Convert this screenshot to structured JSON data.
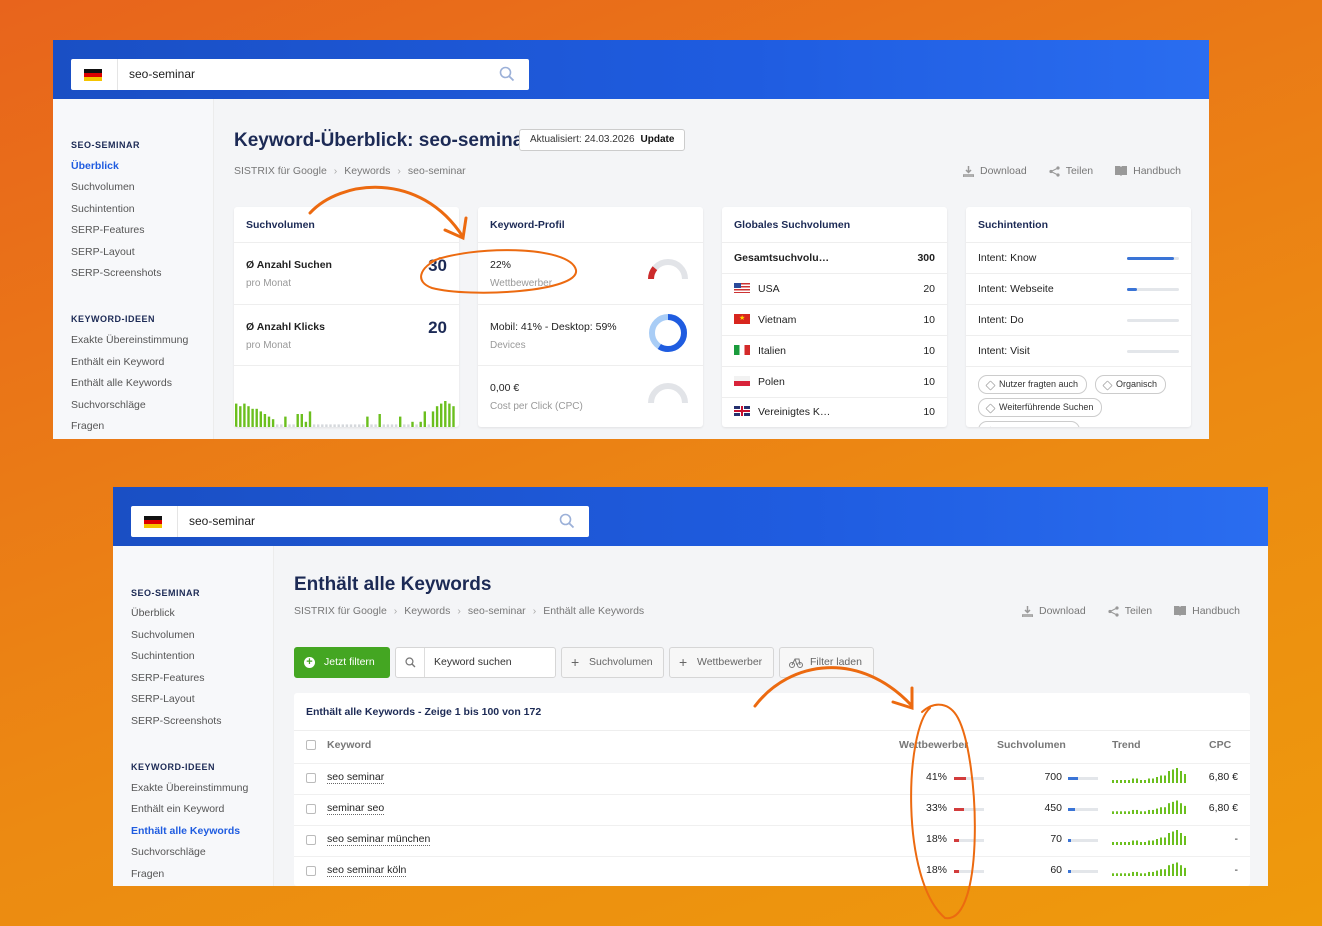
{
  "colors": {
    "accent": "#1f5ce0",
    "green": "#44a622",
    "annotation": "#ec6a10",
    "bar_red": "#d23c3c",
    "bar_blue": "#3a74d6"
  },
  "overview": {
    "search": {
      "query": "seo-seminar"
    },
    "sidebar": {
      "section1": "SEO-SEMINAR",
      "items1": [
        "Überblick",
        "Suchvolumen",
        "Suchintention",
        "SERP-Features",
        "SERP-Layout",
        "SERP-Screenshots"
      ],
      "section2": "KEYWORD-IDEEN",
      "items2": [
        "Exakte Übereinstimmung",
        "Enthält ein Keyword",
        "Enthält alle Keywords",
        "Suchvorschläge",
        "Fragen"
      ]
    },
    "title": "Keyword-Überblick: seo-seminar",
    "updated": "Aktualisiert: 24.03.2026",
    "update_btn": "Update",
    "breadcrumb": [
      "SISTRIX für Google",
      "Keywords",
      "seo-seminar"
    ],
    "actions": {
      "download": "Download",
      "share": "Teilen",
      "manual": "Handbuch"
    },
    "suchvolumen": {
      "title": "Suchvolumen",
      "searches_label": "Ø Anzahl Suchen",
      "searches_sub": "pro Monat",
      "searches_value": "30",
      "clicks_label": "Ø Anzahl Klicks",
      "clicks_sub": "pro Monat",
      "clicks_value": "20"
    },
    "profil": {
      "title": "Keyword-Profil",
      "comp_value": "22%",
      "comp_label": "Wettbewerber",
      "comp_pct": 22,
      "device_value": "Mobil: 41% - Desktop: 59%",
      "device_label": "Devices",
      "mobile_pct": 41,
      "cpc_value": "0,00 €",
      "cpc_label": "Cost per Click (CPC)"
    },
    "global": {
      "title": "Globales Suchvolumen",
      "total_label": "Gesamtsuchvolu…",
      "total_value": "300",
      "countries": [
        {
          "name": "USA",
          "value": "20",
          "flag": "us-flag"
        },
        {
          "name": "Vietnam",
          "value": "10",
          "flag": "vn-flag"
        },
        {
          "name": "Italien",
          "value": "10",
          "flag": "it-flag"
        },
        {
          "name": "Polen",
          "value": "10",
          "flag": "pl-flag"
        },
        {
          "name": "Vereinigtes K…",
          "value": "10",
          "flag": "gb-flag"
        }
      ]
    },
    "intent": {
      "title": "Suchintention",
      "items": [
        {
          "label": "Intent: Know",
          "level": 0.9
        },
        {
          "label": "Intent: Webseite",
          "level": 0.2
        },
        {
          "label": "Intent: Do",
          "level": 0
        },
        {
          "label": "Intent: Visit",
          "level": 0
        }
      ],
      "chips": [
        "Nutzer fragten auch",
        "Organisch",
        "Weiterführende Suchen"
      ]
    }
  },
  "detail": {
    "search": {
      "query": "seo-seminar"
    },
    "sidebar": {
      "section1": "SEO-SEMINAR",
      "items1": [
        "Überblick",
        "Suchvolumen",
        "Suchintention",
        "SERP-Features",
        "SERP-Layout",
        "SERP-Screenshots"
      ],
      "section2": "KEYWORD-IDEEN",
      "items2": [
        "Exakte Übereinstimmung",
        "Enthält ein Keyword",
        "Enthält alle Keywords",
        "Suchvorschläge",
        "Fragen"
      ]
    },
    "title": "Enthält alle Keywords",
    "breadcrumb": [
      "SISTRIX für Google",
      "Keywords",
      "seo-seminar",
      "Enthält alle Keywords"
    ],
    "actions": {
      "download": "Download",
      "share": "Teilen",
      "manual": "Handbuch"
    },
    "filter_btn": "Jetzt filtern",
    "keyword_search_placeholder": "Keyword suchen",
    "add_volume": "Suchvolumen",
    "add_competitor": "Wettbewerber",
    "load_filter": "Filter laden",
    "table_title": "Enthält alle Keywords - Zeige 1 bis 100 von 172",
    "columns": {
      "keyword": "Keyword",
      "competitor": "Wettbewerber",
      "volume": "Suchvolumen",
      "trend": "Trend",
      "cpc": "CPC"
    },
    "rows": [
      {
        "keyword": "seo seminar",
        "competitor": "41%",
        "comp_pct": 41,
        "volume": "700",
        "vol_level": 0.7,
        "cpc": "6,80 €"
      },
      {
        "keyword": "seminar seo",
        "competitor": "33%",
        "comp_pct": 33,
        "volume": "450",
        "vol_level": 0.5,
        "cpc": "6,80 €"
      },
      {
        "keyword": "seo seminar münchen",
        "competitor": "18%",
        "comp_pct": 18,
        "volume": "70",
        "vol_level": 0.15,
        "cpc": "-"
      },
      {
        "keyword": "seo seminar köln",
        "competitor": "18%",
        "comp_pct": 18,
        "volume": "60",
        "vol_level": 0.12,
        "cpc": "-"
      }
    ]
  }
}
